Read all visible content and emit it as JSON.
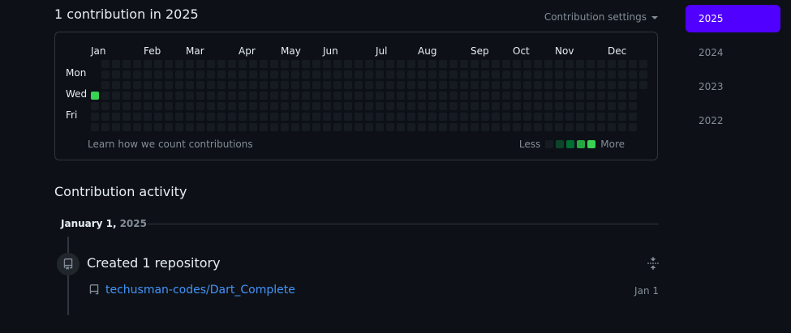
{
  "header": {
    "title": "1 contribution in 2025",
    "settings_label": "Contribution settings"
  },
  "graph": {
    "months": [
      "Jan",
      "Feb",
      "Mar",
      "Apr",
      "May",
      "Jun",
      "Jul",
      "Aug",
      "Sep",
      "Oct",
      "Nov",
      "Dec"
    ],
    "days": [
      "Mon",
      "Wed",
      "Fri"
    ],
    "learn_link": "Learn how we count contributions",
    "legend_less": "Less",
    "legend_more": "More",
    "level_colors": [
      "#161b22",
      "#0e4429",
      "#006d32",
      "#26a641",
      "#39d353"
    ],
    "active_cell_color": "#39d353"
  },
  "years": {
    "items": [
      "2025",
      "2024",
      "2023",
      "2022"
    ],
    "active": "2025",
    "active_color": "#5000ff"
  },
  "activity": {
    "section_title": "Contribution activity",
    "date_label": "January 1,",
    "date_year": "2025",
    "event_title": "Created 1 repository",
    "repo_name": "techusman-codes/Dart_Complete",
    "repo_date": "Jan 1"
  },
  "icons": {
    "collapse": "fold-icon",
    "repo": "repo-icon",
    "caret": "caret-down-icon"
  }
}
